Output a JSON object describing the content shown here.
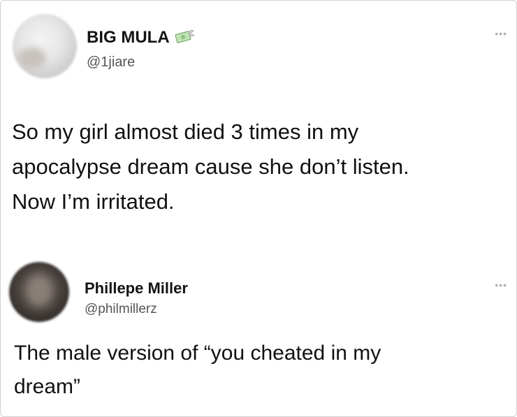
{
  "tweets": [
    {
      "author": {
        "display_name": "BIG MULA",
        "name_emoji": "money-with-wings-icon",
        "handle": "@1jiare"
      },
      "text_lines": [
        "So my girl almost died 3 times in my",
        "apocalypse dream cause she don’t listen.",
        "Now I’m irritated."
      ],
      "more_icon": "more-dots-icon"
    },
    {
      "author": {
        "display_name": "Phillepe Miller",
        "handle": "@philmillerz"
      },
      "text_lines": [
        "The male version of “you cheated in my",
        "dream”"
      ],
      "more_icon": "more-dots-icon"
    }
  ],
  "colors": {
    "background": "#ffffff",
    "text": "#111111",
    "handle": "#555555",
    "more_dots": "#b0b0b0"
  }
}
